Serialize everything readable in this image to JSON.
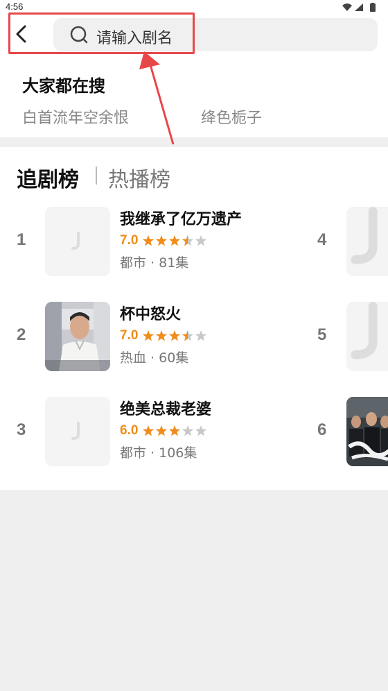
{
  "status_bar": {
    "time": "4:56"
  },
  "search": {
    "placeholder": "请输入剧名"
  },
  "hot_searches": {
    "title": "大家都在搜",
    "items": [
      "白首流年空余恨",
      "绛色栀子"
    ]
  },
  "ranking": {
    "tabs": [
      {
        "label": "追剧榜",
        "active": true
      },
      {
        "label": "热播榜",
        "active": false
      }
    ],
    "items": [
      {
        "rank": "1",
        "title": "我继承了亿万遗产",
        "score": "7.0",
        "stars": 3.5,
        "genre": "都市",
        "episodes": "81集",
        "meta": "都市 · 81集",
        "cover": "placeholder"
      },
      {
        "rank": "2",
        "title": "杯中怒火",
        "score": "7.0",
        "stars": 3.5,
        "genre": "热血",
        "episodes": "60集",
        "meta": "热血 · 60集",
        "cover": "photo"
      },
      {
        "rank": "3",
        "title": "绝美总裁老婆",
        "score": "6.0",
        "stars": 3,
        "genre": "都市",
        "episodes": "106集",
        "meta": "都市 · 106集",
        "cover": "placeholder"
      },
      {
        "rank": "4",
        "cover": "placeholder"
      },
      {
        "rank": "5",
        "cover": "placeholder"
      },
      {
        "rank": "6",
        "cover": "photo"
      }
    ]
  },
  "colors": {
    "accent_orange": "#f08c1a",
    "highlight_red": "#e8474a",
    "star_gray": "#c8c8c8"
  }
}
